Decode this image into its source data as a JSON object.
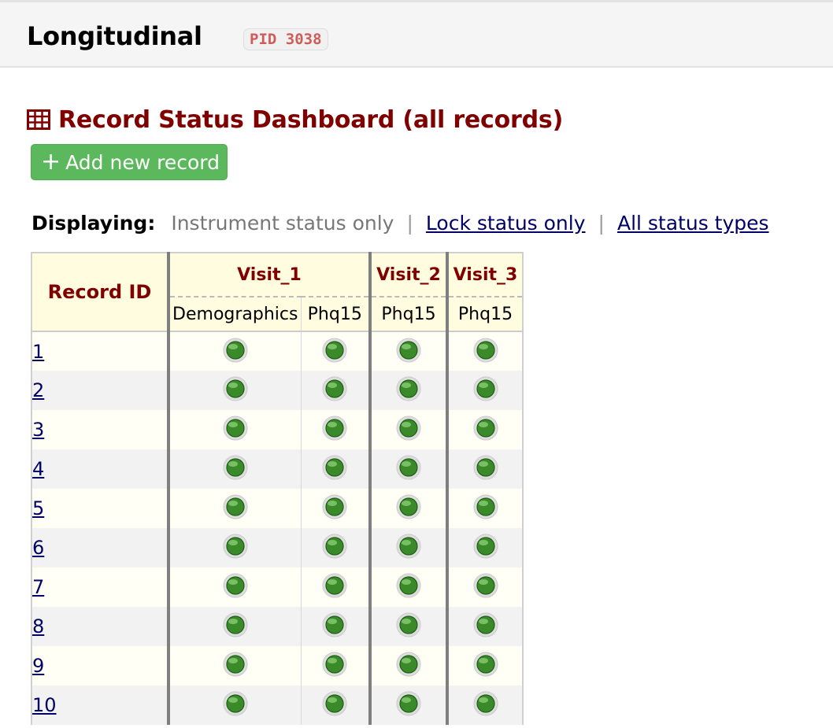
{
  "header": {
    "project_title": "Longitudinal",
    "pid_label": "PID 3038"
  },
  "dashboard": {
    "title": "Record Status Dashboard (all records)",
    "title_icon": "table-icon",
    "add_button": {
      "icon": "plus-icon",
      "label": "Add new record"
    },
    "display": {
      "label": "Displaying:",
      "current": "Instrument status only",
      "links": [
        "Lock status only",
        "All status types"
      ],
      "separator": "|"
    },
    "table": {
      "record_id_header": "Record ID",
      "events": [
        {
          "name": "Visit_1",
          "forms": [
            "Demographics",
            "Phq15"
          ]
        },
        {
          "name": "Visit_2",
          "forms": [
            "Phq15"
          ]
        },
        {
          "name": "Visit_3",
          "forms": [
            "Phq15"
          ]
        }
      ],
      "status_icon": "complete-status-icon",
      "status_color": "#3a8a2a",
      "rows": [
        {
          "record_id": "1"
        },
        {
          "record_id": "2"
        },
        {
          "record_id": "3"
        },
        {
          "record_id": "4"
        },
        {
          "record_id": "5"
        },
        {
          "record_id": "6"
        },
        {
          "record_id": "7"
        },
        {
          "record_id": "8"
        },
        {
          "record_id": "9"
        },
        {
          "record_id": "10"
        }
      ]
    }
  }
}
